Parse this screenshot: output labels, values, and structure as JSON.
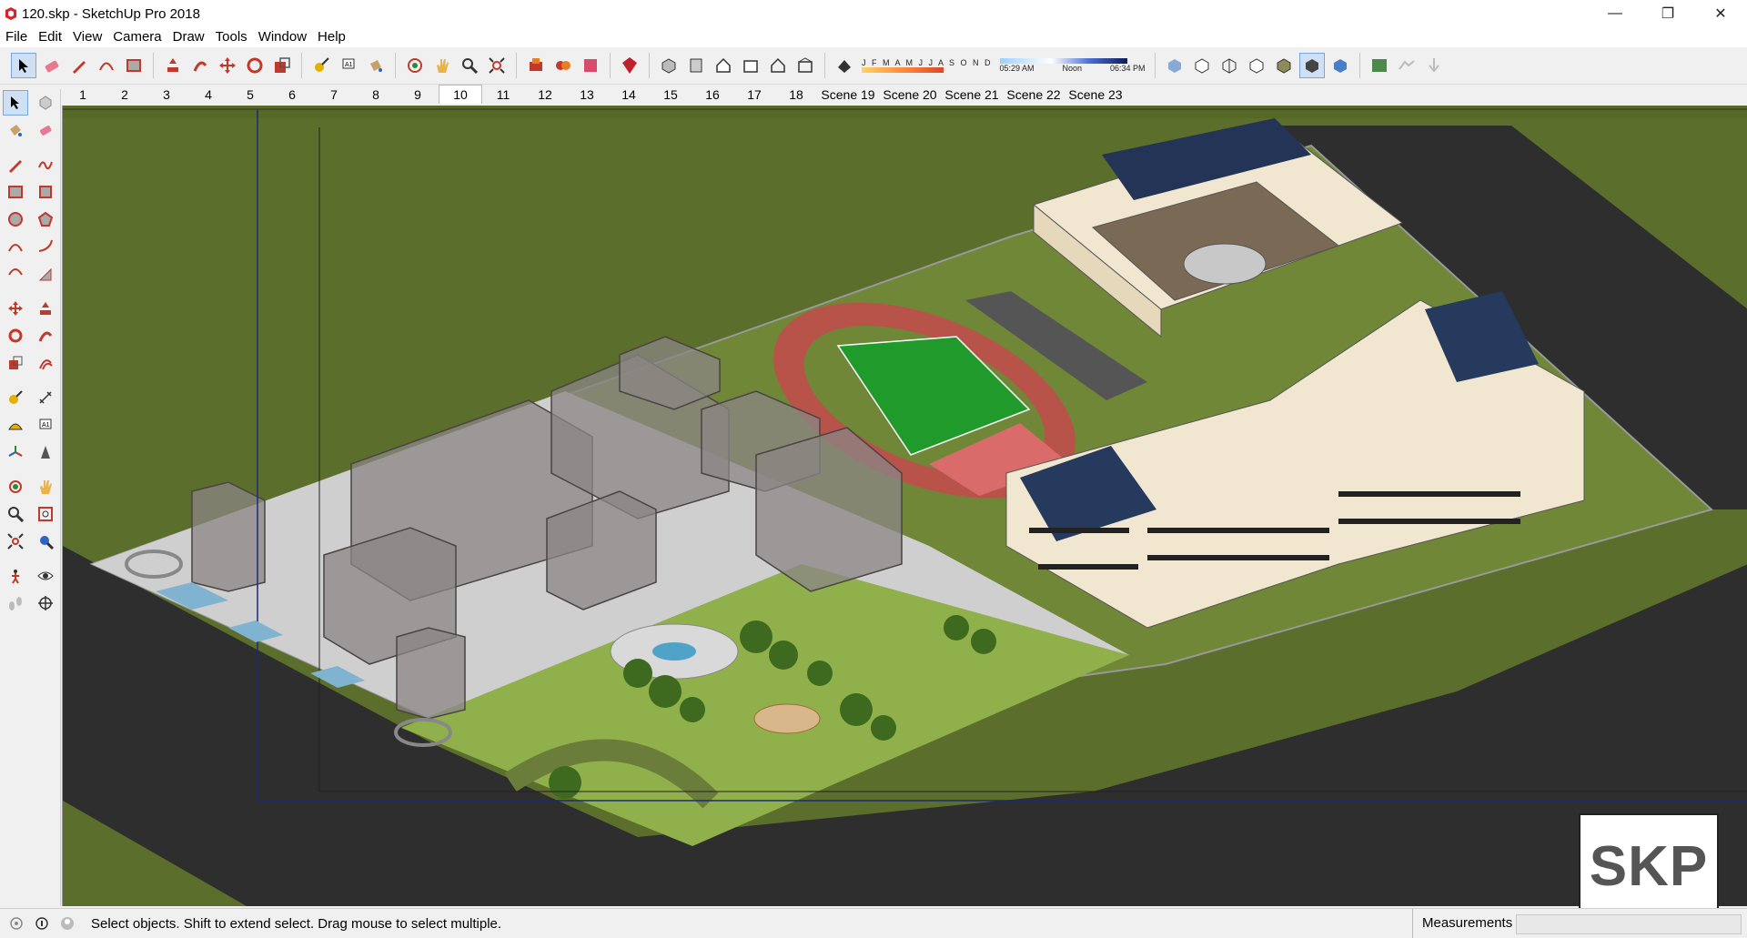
{
  "window": {
    "title": "120.skp - SketchUp Pro 2018",
    "minimize": "—",
    "restore": "❐",
    "close": "✕"
  },
  "menu": [
    "File",
    "Edit",
    "View",
    "Camera",
    "Draw",
    "Tools",
    "Window",
    "Help"
  ],
  "shadow_settings": {
    "months": "J F M A M J J A S O N D",
    "time_start": "05:29 AM",
    "time_mid": "Noon",
    "time_end": "06:34 PM"
  },
  "scenes": [
    "1",
    "2",
    "3",
    "4",
    "5",
    "6",
    "7",
    "8",
    "9",
    "10",
    "11",
    "12",
    "13",
    "14",
    "15",
    "16",
    "17",
    "18",
    "Scene 19",
    "Scene 20",
    "Scene 21",
    "Scene 22",
    "Scene 23"
  ],
  "active_scene_index": 9,
  "status": {
    "hint": "Select objects. Shift to extend select. Drag mouse to select multiple.",
    "measurements_label": "Measurements",
    "measurements_value": ""
  },
  "watermark": "SKP",
  "colors": {
    "grass": "#5c6e2b",
    "asphalt": "#2e2e2e",
    "pavement": "#cfcfcf",
    "field": "#1f9a2b",
    "track": "#b8534a",
    "building": "#f1e6cf"
  }
}
